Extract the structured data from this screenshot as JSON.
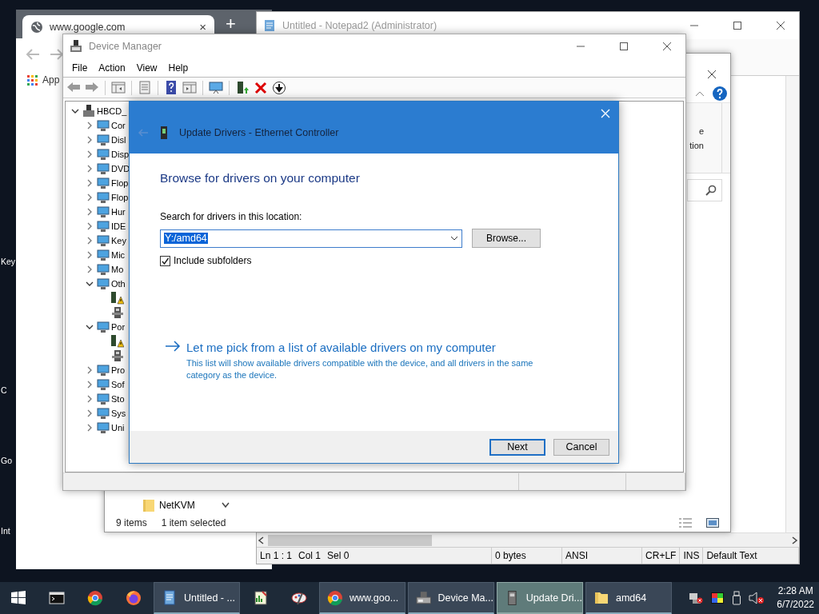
{
  "desktop_labels": [
    {
      "text": "Key"
    },
    {
      "text": "C"
    },
    {
      "text": "Go"
    },
    {
      "text": "Int"
    }
  ],
  "browser": {
    "tab": {
      "title": "www.google.com",
      "close": "×"
    },
    "new_tab": "+",
    "bookmarks": [
      "App"
    ]
  },
  "notepad": {
    "title": "Untitled - Notepad2 (Administrator)",
    "status_bar": [
      "Ln 1 : 1",
      "Col 1",
      "Sel 0",
      "0 bytes",
      "ANSI",
      "CR+LF",
      "INS",
      "Default Text"
    ]
  },
  "explorer": {
    "ribbon_labels": [
      "e",
      "tion"
    ],
    "folders": [
      {
        "name": "NetKVM"
      }
    ],
    "status": {
      "count": "9 items",
      "selection": "1 item selected"
    }
  },
  "device_manager": {
    "title": "Device Manager",
    "menu": [
      "File",
      "Action",
      "View",
      "Help"
    ],
    "tree": [
      {
        "label": "HBCD_",
        "expanded": true,
        "children": [
          {
            "label": "Cor",
            "expanded": false
          },
          {
            "label": "Disl",
            "expanded": false
          },
          {
            "label": "Disp",
            "expanded": false
          },
          {
            "label": "DVD",
            "expanded": false
          },
          {
            "label": "Flop",
            "expanded": false
          },
          {
            "label": "Flop",
            "expanded": false
          },
          {
            "label": "Hur",
            "expanded": false
          },
          {
            "label": "IDE",
            "expanded": false
          },
          {
            "label": "Key",
            "expanded": false
          },
          {
            "label": "Mic",
            "expanded": false
          },
          {
            "label": "Mo",
            "expanded": false
          },
          {
            "label": "Oth",
            "expanded": true,
            "children": [
              {
                "warning": true
              },
              {
                "warning": false
              }
            ]
          },
          {
            "label": "Por",
            "expanded": true,
            "children": [
              {
                "warning": true
              },
              {
                "warning": false
              }
            ]
          },
          {
            "label": "Pro",
            "expanded": false
          },
          {
            "label": "Sof",
            "expanded": false
          },
          {
            "label": "Sto",
            "expanded": false
          },
          {
            "label": "Sys",
            "expanded": false
          },
          {
            "label": "Uni",
            "expanded": false
          }
        ]
      }
    ]
  },
  "update_dialog": {
    "title": "Update Drivers - Ethernet Controller",
    "heading": "Browse for drivers on your computer",
    "location_label": "Search for drivers in this location:",
    "location": {
      "value": "Y:/amd64",
      "text_selected": true
    },
    "browse_button": "Browse...",
    "include_subfolders": {
      "label": "Include subfolders",
      "checked": true
    },
    "pick_link": {
      "label": "Let me pick from a list of available drivers on my computer",
      "description": "This list will show available drivers compatible with the device, and all drivers in the same category as the device."
    },
    "buttons": [
      {
        "label": "Next",
        "default": true
      },
      {
        "label": "Cancel",
        "default": false
      }
    ]
  },
  "taskbar": {
    "items": [
      {
        "kind": "icon"
      },
      {
        "kind": "icon"
      },
      {
        "kind": "icon"
      },
      {
        "kind": "icon"
      },
      {
        "kind": "window",
        "label": "Untitled - ...",
        "selected": false
      },
      {
        "kind": "icon"
      },
      {
        "kind": "icon"
      },
      {
        "kind": "window",
        "label": "www.goo...",
        "selected": false
      },
      {
        "kind": "window",
        "label": "Device Ma...",
        "selected": false
      },
      {
        "kind": "window",
        "label": "Update Dri...",
        "selected": true
      },
      {
        "kind": "window",
        "label": "amd64",
        "selected": false
      }
    ],
    "clock": {
      "time": "2:28 AM",
      "date": "6/7/2022"
    }
  }
}
